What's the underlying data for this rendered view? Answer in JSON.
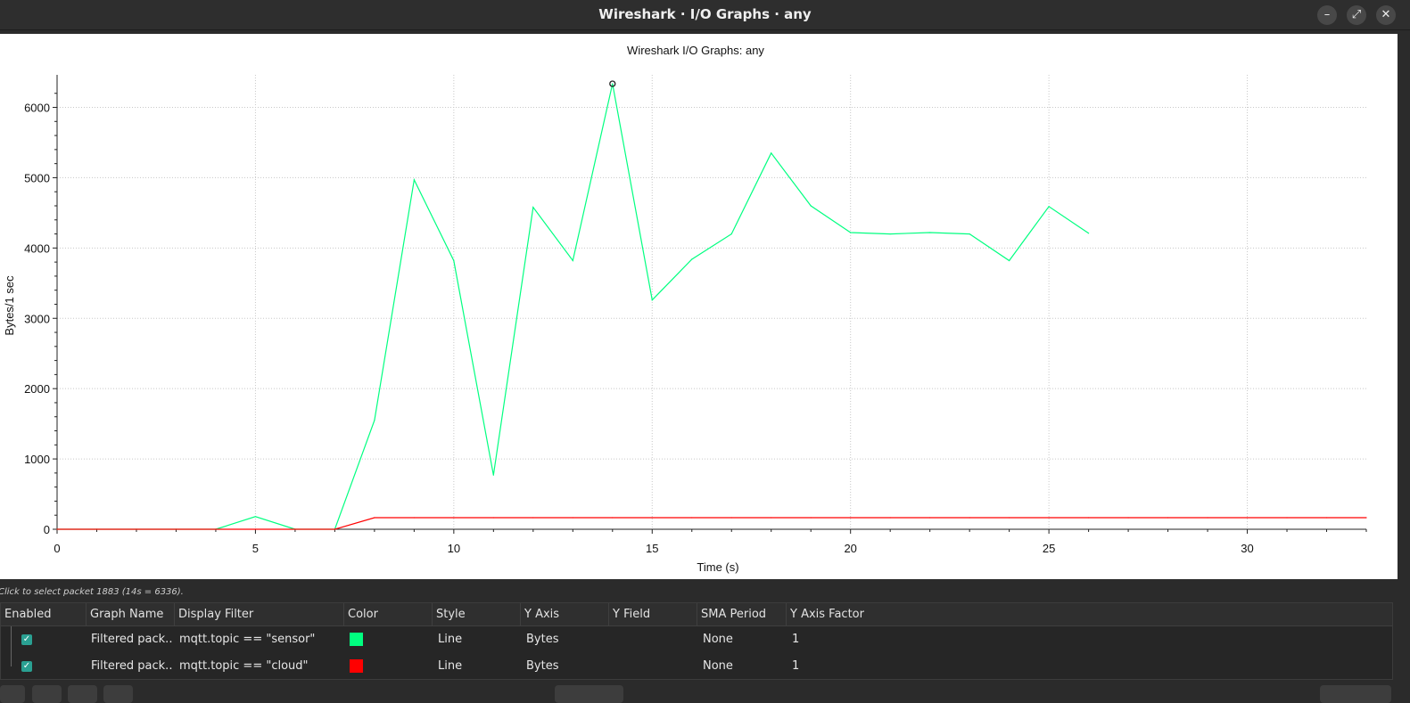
{
  "window": {
    "title": "Wireshark · I/O Graphs · any",
    "controls": [
      "minimize-icon",
      "maximize-icon",
      "close-icon"
    ]
  },
  "status": "Click to select packet 1883 (14s = 6336).",
  "table": {
    "headers": [
      "Enabled",
      "Graph Name",
      "Display Filter",
      "Color",
      "Style",
      "Y Axis",
      "Y Field",
      "SMA Period",
      "Y Axis Factor"
    ],
    "rows": [
      {
        "enabled": true,
        "name": "Filtered pack...",
        "filter": "mqtt.topic == \"sensor\"",
        "color": "#00ff80",
        "style": "Line",
        "y_axis": "Bytes",
        "y_field": "",
        "sma": "None",
        "factor": "1"
      },
      {
        "enabled": true,
        "name": "Filtered pack...",
        "filter": "mqtt.topic == \"cloud\"",
        "color": "#ff0000",
        "style": "Line",
        "y_axis": "Bytes",
        "y_field": "",
        "sma": "None",
        "factor": "1"
      }
    ]
  },
  "chart_data": {
    "type": "line",
    "title": "Wireshark I/O Graphs: any",
    "xlabel": "Time (s)",
    "ylabel": "Bytes/1 sec",
    "xlim": [
      0,
      33
    ],
    "ylim": [
      0,
      6336
    ],
    "x_ticks": [
      0,
      5,
      10,
      15,
      20,
      25,
      30
    ],
    "y_ticks": [
      0,
      1000,
      2000,
      3000,
      4000,
      5000,
      6000
    ],
    "grid": true,
    "highlight_point": {
      "x": 14,
      "y": 6336
    },
    "series": [
      {
        "color": "#00ff80",
        "x": [
          0,
          1,
          2,
          3,
          4,
          5,
          6,
          7,
          8,
          9,
          10,
          11,
          12,
          13,
          14,
          15,
          16,
          17,
          18,
          19,
          20,
          21,
          22,
          23,
          24,
          25,
          26
        ],
        "y": [
          0,
          0,
          0,
          0,
          0,
          180,
          0,
          0,
          1550,
          4970,
          3820,
          770,
          4580,
          3820,
          6336,
          3260,
          3840,
          4200,
          5350,
          4600,
          4220,
          4200,
          4220,
          4200,
          3820,
          4590,
          4210
        ]
      },
      {
        "color": "#ff0000",
        "x": [
          0,
          1,
          2,
          3,
          4,
          5,
          6,
          7,
          8,
          9,
          10,
          11,
          12,
          13,
          14,
          15,
          16,
          17,
          18,
          19,
          20,
          21,
          22,
          23,
          24,
          25,
          26,
          27,
          28,
          29,
          30,
          31,
          32,
          33
        ],
        "y": [
          0,
          0,
          0,
          0,
          0,
          0,
          0,
          0,
          165,
          165,
          165,
          165,
          165,
          165,
          165,
          165,
          165,
          165,
          165,
          165,
          165,
          165,
          165,
          165,
          165,
          165,
          165,
          165,
          165,
          165,
          165,
          165,
          165,
          165
        ]
      }
    ]
  }
}
